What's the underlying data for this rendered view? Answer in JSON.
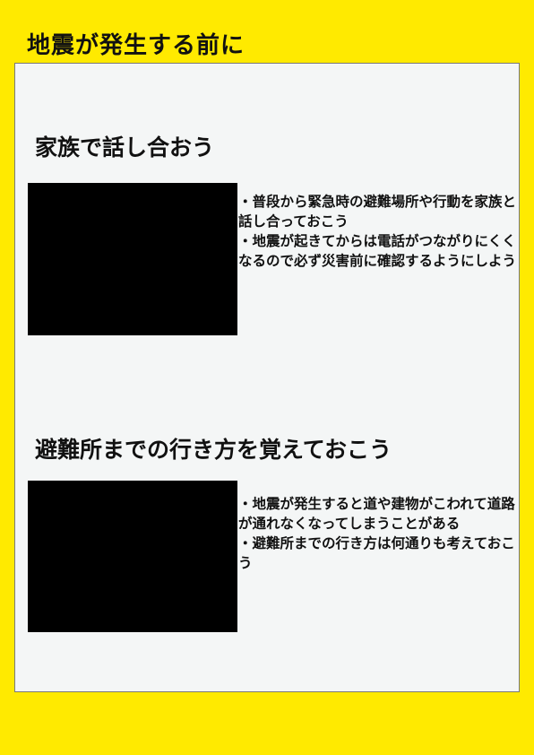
{
  "title": "地震が発生する前に",
  "sections": [
    {
      "heading": "家族で話し合おう",
      "notes": [
        "・普段から緊急時の避難場所や行動を家族と話し合っておこう",
        "・地震が起きてからは電話がつながりにくくなるので必ず災害前に確認するようにしよう"
      ]
    },
    {
      "heading": "避難所までの行き方を覚えておこう",
      "notes": [
        "・地震が発生すると道や建物がこわれて道路が通れなくなってしまうことがある",
        "・避難所までの行き方は何通りも考えておこう"
      ]
    }
  ],
  "colors": {
    "page_background": "#FFEA00",
    "panel_background": "#F4F6F6",
    "image_placeholder": "#000000",
    "text": "#111111"
  }
}
